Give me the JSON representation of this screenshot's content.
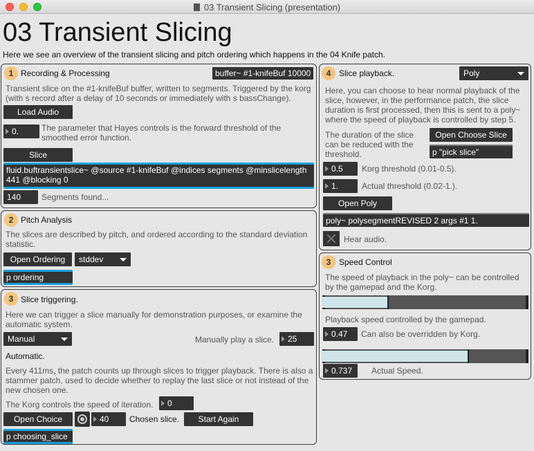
{
  "window": {
    "title": "03 Transient Slicing (presentation)"
  },
  "page": {
    "title": "03 Transient Slicing",
    "subtitle": "Here we see an overview of the transient slicing and pitch ordering which happens in the 04 Knife patch."
  },
  "recording": {
    "badge": "1",
    "heading": "Recording & Processing",
    "buffer_object": "buffer~ #1-knifeBuf 10000",
    "description": "Transient slice on the #1-knifeBuf buffer, written to segments. Triggered by the korg (with s record after a delay of 10 seconds or immediately with s bassChange).",
    "load_audio_label": "Load Audio",
    "threshold_value": "0.",
    "threshold_description": "The parameter that Hayes controls is the forward threshold of the smoothed error function.",
    "slice_label": "Slice",
    "slice_object_line1": "fluid.buftransientslice~ @source #1-knifeBuf @indices segments @minslicelength",
    "slice_object_line2": "441 @blocking 0",
    "segments_count": "140",
    "segments_label": "Segments found..."
  },
  "pitch": {
    "badge": "2",
    "heading": "Pitch Analysis",
    "description": "The slices are described by pitch, and ordered according to the standard deviation statistic.",
    "open_ordering_label": "Open Ordering",
    "stat_menu_value": "stddev",
    "ordering_object": "p ordering"
  },
  "triggering": {
    "badge": "3",
    "heading": "Slice triggering.",
    "description": "Here we can trigger a slice manually for demonstration purposes, or examine the automatic system.",
    "mode_menu_value": "Manual",
    "manual_label": "Manually play a slice.",
    "manual_value": "25",
    "automatic_label": "Automatic.",
    "automatic_description": "Every 411ms, the patch counts up through slices to trigger playback. There is also a stammer patch, used to decide whether to replay the last slice or not instead of the new chosen one.",
    "korg_label": "The Korg controls the speed of iteration.",
    "korg_value": "0",
    "open_choice_label": "Open Choice",
    "chosen_value": "40",
    "chosen_label": "Chosen slice.",
    "start_again_label": "Start Again",
    "choosing_object": "p choosing_slice"
  },
  "playback": {
    "badge": "4",
    "heading": "Slice playback.",
    "mode_menu_value": "Poly",
    "description": "Here, you can choose to hear normal playback of the slice, however, in the performance patch, the slice duration is first processed, then this is sent to a poly~ where the speed of playback is controlled by step 5.",
    "duration_description": "The duration of the slice can be reduced with the threshold.",
    "open_choose_slice_label": "Open Choose Slice",
    "pick_slice_object": "p \"pick slice\"",
    "korg_threshold_value": "0.5",
    "korg_threshold_label": "Korg threshold (0.01-0.5).",
    "actual_threshold_value": "1.",
    "actual_threshold_label": "Actual threshold (0.02-1.).",
    "open_poly_label": "Open Poly",
    "poly_object": "poly~ polysegmentREVISED 2 args #1 1.",
    "hear_audio_label": "Hear audio."
  },
  "speed": {
    "badge": "3",
    "heading": "Speed Control",
    "description": "The speed of playback in the poly~ can be controlled by the gamepad and the Korg.",
    "gamepad_slider_level": 0.31,
    "gamepad_label": "Playback speed controlled by the gamepad.",
    "override_value": "0.47",
    "override_label": "Can also be overridden by Korg.",
    "actual_slider_level": 0.71,
    "actual_value": "0.737",
    "actual_label": "Actual Speed."
  }
}
